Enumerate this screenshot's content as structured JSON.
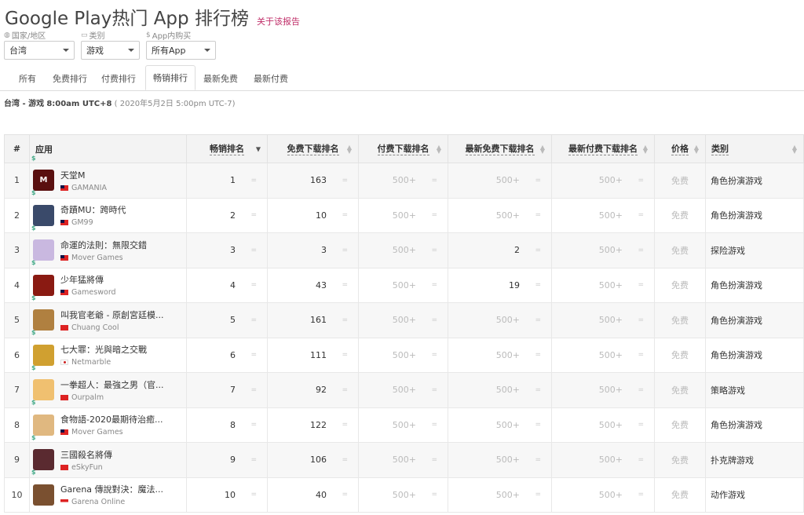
{
  "header": {
    "title": "Google Play热门 App 排行榜",
    "report_link": "关于该报告"
  },
  "filters": [
    {
      "label": "国家/地区",
      "icon": "globe-icon",
      "value": "台湾"
    },
    {
      "label": "类别",
      "icon": "folder-icon",
      "value": "游戏"
    },
    {
      "label": "App内购买",
      "icon": "dollar-icon",
      "value": "所有App"
    }
  ],
  "tabs": [
    "所有",
    "免费排行",
    "付费排行",
    "畅销排行",
    "最新免费",
    "最新付费"
  ],
  "active_tab": "畅销排行",
  "meta": {
    "scope": "台湾 - 游戏",
    "time": "8:00am UTC+8",
    "alt_time": "( 2020年5月2日 5:00pm UTC-7)"
  },
  "table": {
    "headers": [
      "#",
      "应用",
      "畅销排名",
      "免费下载排名",
      "付费下载排名",
      "最新免费下载排名",
      "最新付费下载排名",
      "价格",
      "类别"
    ],
    "rows": [
      {
        "rank": "1",
        "name": "天堂M",
        "dev": "GAMANIA",
        "flag": "tw",
        "grossing": "1",
        "free": "163",
        "paid": "500+",
        "new_free": "500+",
        "new_paid": "500+",
        "price": "免费",
        "category": "角色扮演游戏",
        "icon_color": "#5a1010",
        "icon_text": "M"
      },
      {
        "rank": "2",
        "name": "奇蹟MU：跨時代",
        "dev": "GM99",
        "flag": "tw",
        "grossing": "2",
        "free": "10",
        "paid": "500+",
        "new_free": "500+",
        "new_paid": "500+",
        "price": "免费",
        "category": "角色扮演游戏",
        "icon_color": "#3a4a6a",
        "icon_text": ""
      },
      {
        "rank": "3",
        "name": "命運的法則：無限交錯",
        "dev": "Mover Games",
        "flag": "tw",
        "grossing": "3",
        "free": "3",
        "paid": "500+",
        "new_free": "2",
        "new_paid": "500+",
        "price": "免费",
        "category": "探险游戏",
        "icon_color": "#c9b8e0",
        "icon_text": ""
      },
      {
        "rank": "4",
        "name": "少年猛將傳",
        "dev": "Gamesword",
        "flag": "tw",
        "grossing": "4",
        "free": "43",
        "paid": "500+",
        "new_free": "19",
        "new_paid": "500+",
        "price": "免费",
        "category": "角色扮演游戏",
        "icon_color": "#8a1a12",
        "icon_text": ""
      },
      {
        "rank": "5",
        "name": "叫我官老爺 - 原創宮廷模...",
        "dev": "Chuang Cool",
        "flag": "cn",
        "grossing": "5",
        "free": "161",
        "paid": "500+",
        "new_free": "500+",
        "new_paid": "500+",
        "price": "免费",
        "category": "角色扮演游戏",
        "icon_color": "#b08040",
        "icon_text": ""
      },
      {
        "rank": "6",
        "name": "七大罪：光與暗之交戰",
        "dev": "Netmarble",
        "flag": "kr",
        "grossing": "6",
        "free": "111",
        "paid": "500+",
        "new_free": "500+",
        "new_paid": "500+",
        "price": "免费",
        "category": "角色扮演游戏",
        "icon_color": "#d0a030",
        "icon_text": ""
      },
      {
        "rank": "7",
        "name": "一拳超人：最強之男（官...",
        "dev": "Ourpalm",
        "flag": "cn",
        "grossing": "7",
        "free": "92",
        "paid": "500+",
        "new_free": "500+",
        "new_paid": "500+",
        "price": "免费",
        "category": "策略游戏",
        "icon_color": "#f0c070",
        "icon_text": ""
      },
      {
        "rank": "8",
        "name": "食物語-2020最期待治癒...",
        "dev": "Mover Games",
        "flag": "tw",
        "grossing": "8",
        "free": "122",
        "paid": "500+",
        "new_free": "500+",
        "new_paid": "500+",
        "price": "免费",
        "category": "角色扮演游戏",
        "icon_color": "#e0b880",
        "icon_text": ""
      },
      {
        "rank": "9",
        "name": "三國殺名將傳",
        "dev": "eSkyFun",
        "flag": "cn",
        "grossing": "9",
        "free": "106",
        "paid": "500+",
        "new_free": "500+",
        "new_paid": "500+",
        "price": "免费",
        "category": "扑克牌游戏",
        "icon_color": "#5a2a30",
        "icon_text": ""
      },
      {
        "rank": "10",
        "name": "Garena 傳說對決：魔法...",
        "dev": "Garena Online",
        "flag": "sg",
        "grossing": "10",
        "free": "40",
        "paid": "500+",
        "new_free": "500+",
        "new_paid": "500+",
        "price": "免费",
        "category": "动作游戏",
        "icon_color": "#7a5030",
        "icon_text": ""
      }
    ]
  },
  "colors": {
    "accent_link": "#c0306a",
    "header_bg": "#f3f3f3",
    "alt_row_bg": "#f7f7f7"
  }
}
